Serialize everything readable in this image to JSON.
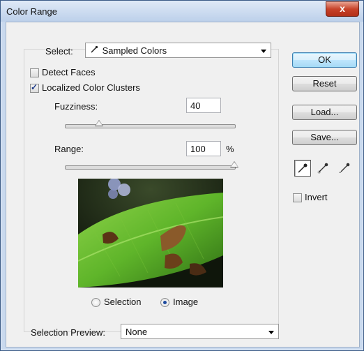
{
  "window": {
    "title": "Color Range",
    "close_label": "x"
  },
  "select": {
    "label": "Select:",
    "value": "Sampled Colors"
  },
  "options": {
    "detect_faces": {
      "label": "Detect Faces",
      "checked": false
    },
    "localized_clusters": {
      "label": "Localized Color Clusters",
      "checked": true
    }
  },
  "fuzziness": {
    "label": "Fuzziness:",
    "value": "40",
    "slider_fraction": 0.2
  },
  "range": {
    "label": "Range:",
    "value": "100",
    "unit": "%",
    "slider_fraction": 1.0
  },
  "preview_mode": {
    "selection_label": "Selection",
    "image_label": "Image",
    "selected": "image"
  },
  "selection_preview": {
    "label": "Selection Preview:",
    "value": "None"
  },
  "buttons": {
    "ok": "OK",
    "reset": "Reset",
    "load": "Load...",
    "save": "Save..."
  },
  "tools": [
    {
      "name": "eyedropper-icon",
      "active": true
    },
    {
      "name": "eyedropper-plus-icon",
      "active": false
    },
    {
      "name": "eyedropper-minus-icon",
      "active": false
    }
  ],
  "invert": {
    "label": "Invert",
    "checked": false
  },
  "colors": {
    "title_bar": "#c9d9ee",
    "close_red": "#c7432a",
    "leaf_green": "#5fb52a"
  }
}
